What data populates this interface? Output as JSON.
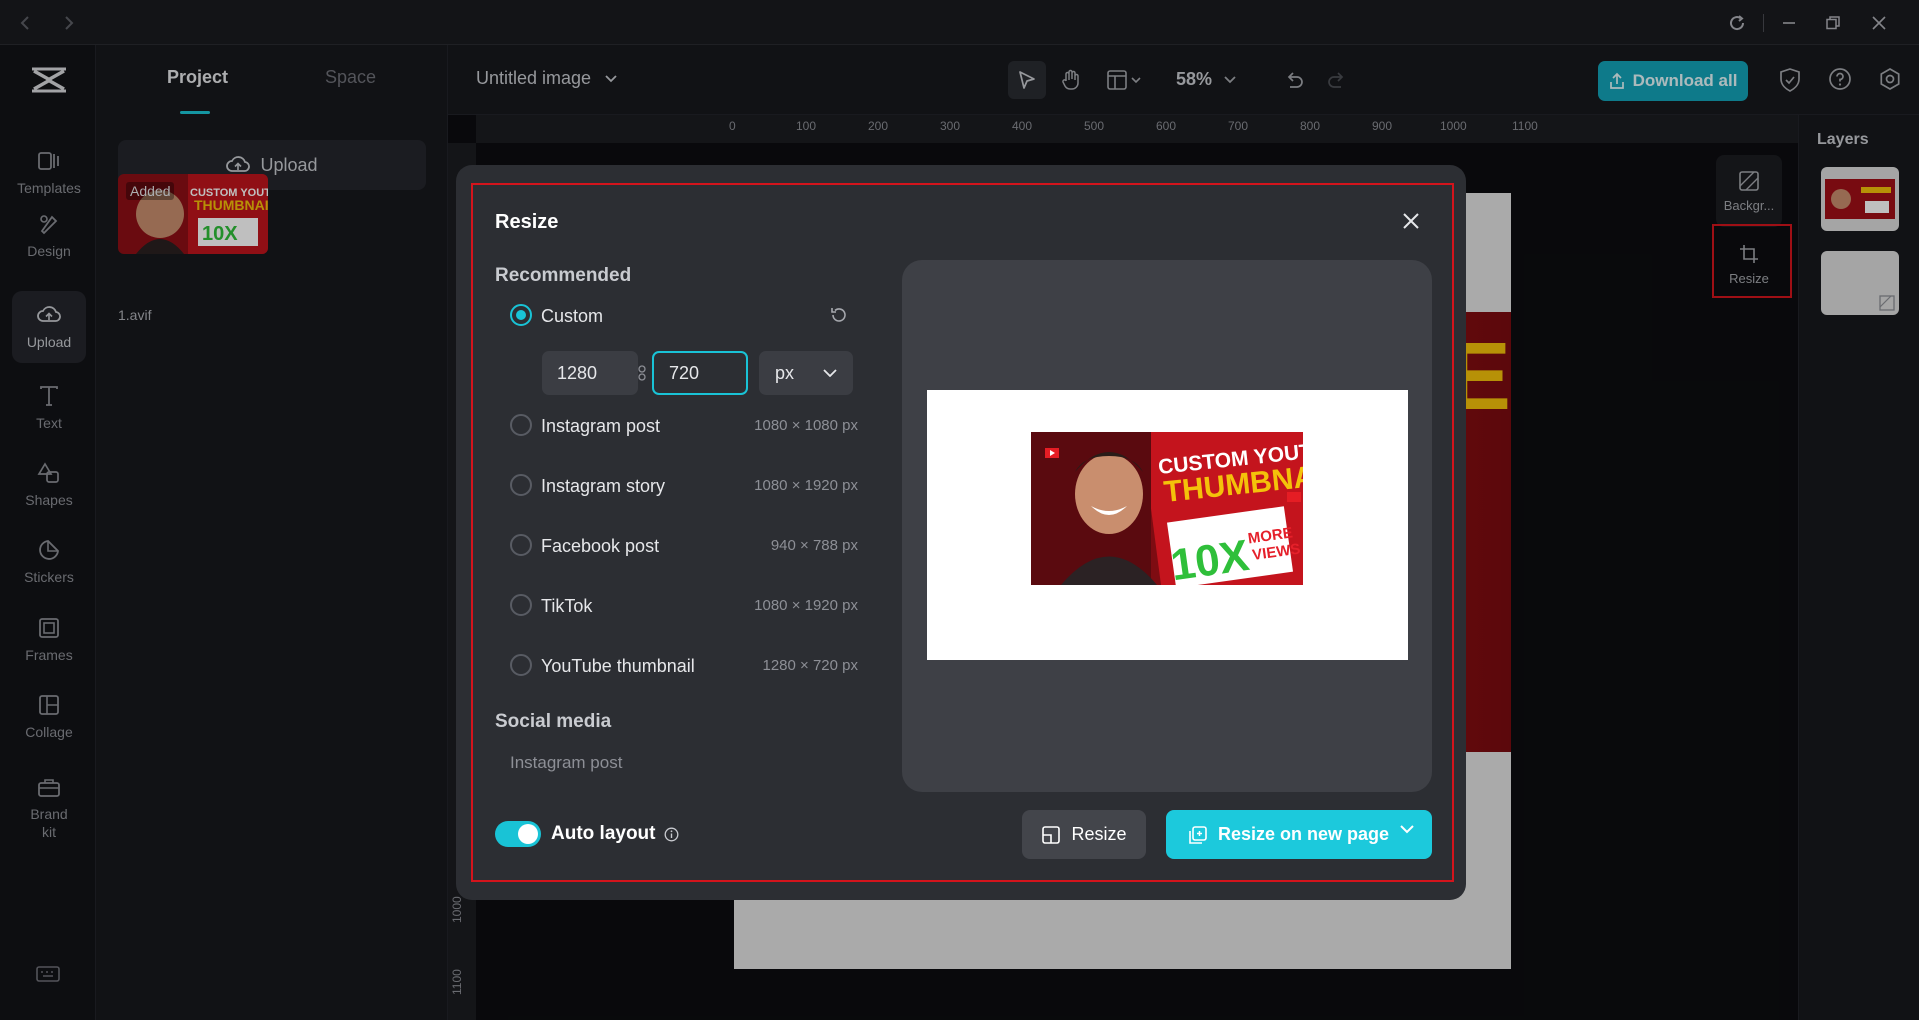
{
  "app": {
    "nav_back_icon": "chevron-left-icon",
    "nav_forward_icon": "chevron-right-icon",
    "window_controls": [
      "refresh-icon",
      "minimize-icon",
      "restore-icon",
      "close-icon"
    ]
  },
  "rail": {
    "items": [
      {
        "label": "Templates",
        "icon": "templates-icon"
      },
      {
        "label": "Design",
        "icon": "design-icon"
      },
      {
        "label": "Upload",
        "icon": "cloud-upload-icon"
      },
      {
        "label": "Text",
        "icon": "text-icon"
      },
      {
        "label": "Shapes",
        "icon": "shapes-icon"
      },
      {
        "label": "Stickers",
        "icon": "stickers-icon"
      },
      {
        "label": "Frames",
        "icon": "frames-icon"
      },
      {
        "label": "Collage",
        "icon": "collage-icon"
      },
      {
        "label": "Brand\nkit",
        "icon": "brand-kit-icon"
      }
    ],
    "active": "Upload"
  },
  "panel": {
    "tabs": [
      "Project",
      "Space"
    ],
    "active_tab": "Project",
    "upload_label": "Upload",
    "asset": {
      "badge": "Added",
      "filename": "1.avif"
    }
  },
  "topbar": {
    "doc_title": "Untitled image",
    "zoom": "58%",
    "download_label": "Download all"
  },
  "ruler": {
    "h_ticks": [
      "0",
      "100",
      "200",
      "300",
      "400",
      "500",
      "600",
      "700",
      "800",
      "900",
      "1000",
      "1100"
    ],
    "v_ticks": [
      "1000",
      "1100"
    ]
  },
  "side_tools": {
    "background_label": "Backgr...",
    "resize_label": "Resize"
  },
  "layers": {
    "title": "Layers"
  },
  "modal": {
    "title": "Resize",
    "recommended_heading": "Recommended",
    "custom": {
      "label": "Custom",
      "width": "1280",
      "height": "720",
      "unit": "px"
    },
    "presets": [
      {
        "name": "Instagram post",
        "size": "1080 × 1080 px"
      },
      {
        "name": "Instagram story",
        "size": "1080 × 1920 px"
      },
      {
        "name": "Facebook post",
        "size": "940 × 788 px"
      },
      {
        "name": "TikTok",
        "size": "1080 × 1920 px"
      },
      {
        "name": "YouTube thumbnail",
        "size": "1280 × 720 px"
      }
    ],
    "social_heading": "Social media",
    "social_first": "Instagram post",
    "auto_layout_label": "Auto layout",
    "auto_layout_on": true,
    "resize_button": "Resize",
    "resize_new_page_button": "Resize on new page",
    "thumbnail_text": {
      "line1": "CUSTOM YOUTUBE",
      "line2": "THUMBNAIL",
      "big": "10X",
      "small1": "MORE",
      "small2": "VIEWS"
    }
  },
  "colors": {
    "accent": "#19c3d6",
    "highlight_box": "#d4141c",
    "download_button": "#13a3b8"
  }
}
